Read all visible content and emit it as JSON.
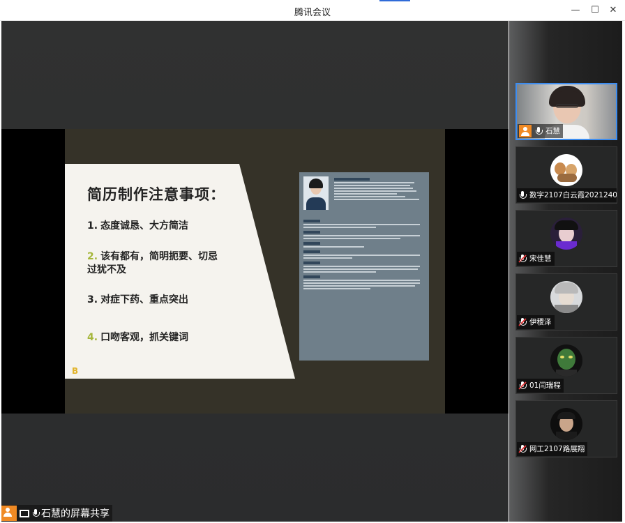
{
  "window": {
    "title": "腾讯会议",
    "minimize_glyph": "—",
    "maximize_glyph": "☐",
    "close_glyph": "✕"
  },
  "slide": {
    "heading": "简历制作注意事项：",
    "items": [
      {
        "num": "1.",
        "text": "态度诚恳、大方简洁"
      },
      {
        "num": "2.",
        "text": "该有都有，简明扼要、切忌过犹不及"
      },
      {
        "num": "3.",
        "text": "对症下药、重点突出"
      },
      {
        "num": "4.",
        "text": "口吻客观，抓关键词"
      }
    ],
    "logo_glyph": "B"
  },
  "participants": [
    {
      "name": "石慧",
      "host": true,
      "muted": false,
      "active": true
    },
    {
      "name": "数字2107白云霞2021240...",
      "host": false,
      "muted": false,
      "active": false
    },
    {
      "name": "宋佳慧",
      "host": false,
      "muted": true,
      "active": false
    },
    {
      "name": "伊稷泽",
      "host": false,
      "muted": true,
      "active": false
    },
    {
      "name": "01闫瑞程",
      "host": false,
      "muted": true,
      "active": false
    },
    {
      "name": "网工2107路展翔",
      "host": false,
      "muted": true,
      "active": false
    }
  ],
  "share_status": {
    "label": "石慧的屏幕共享"
  },
  "colors": {
    "accent": "#2f6bd8",
    "host_badge": "#f08a24",
    "active_border": "#3d8df0",
    "muted": "#e2383a",
    "slide_bg": "#353228",
    "resume_bg": "#6f7f8a"
  }
}
